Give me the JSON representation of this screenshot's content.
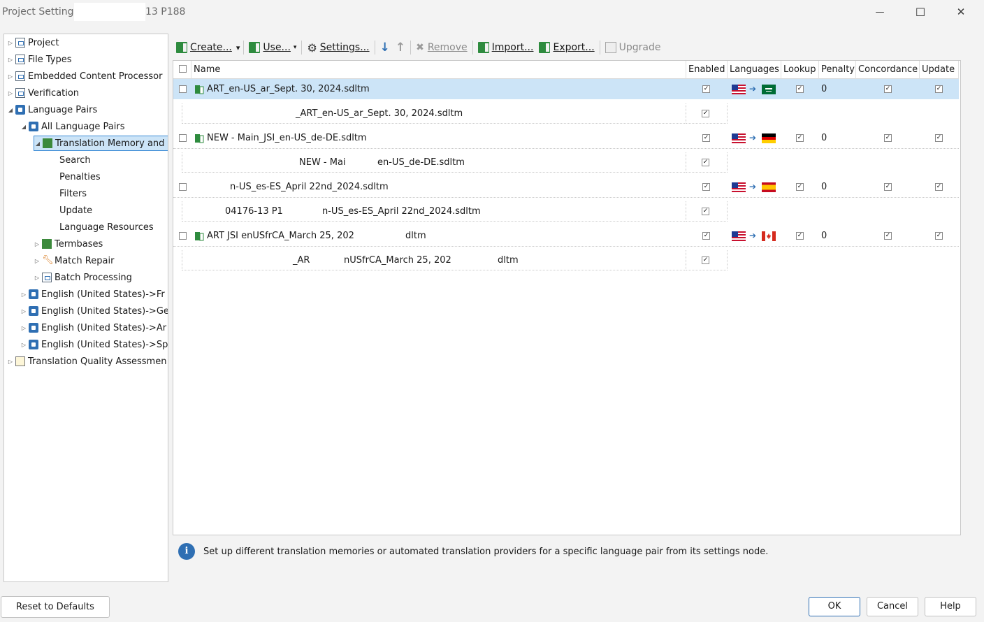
{
  "window": {
    "title_left": "Project Settings",
    "title_right": "13 P188",
    "minimize_glyph": "—",
    "maximize_glyph": "☐",
    "close_glyph": "✕"
  },
  "tree": {
    "items": [
      {
        "label": "Project",
        "icon": "project-icon"
      },
      {
        "label": "File Types",
        "icon": "file-types-icon"
      },
      {
        "label": "Embedded Content Processor",
        "icon": "embedded-content-icon"
      },
      {
        "label": "Verification",
        "icon": "verification-icon"
      },
      {
        "label": "Language Pairs",
        "icon": "language-pairs-icon"
      },
      {
        "label": "All Language Pairs",
        "icon": "language-pairs-icon"
      },
      {
        "label": "Translation Memory and",
        "icon": "translation-memory-icon"
      },
      {
        "label": "Search"
      },
      {
        "label": "Penalties"
      },
      {
        "label": "Filters"
      },
      {
        "label": "Update"
      },
      {
        "label": "Language Resources"
      },
      {
        "label": "Termbases",
        "icon": "termbase-icon"
      },
      {
        "label": "Match Repair",
        "icon": "wrench-icon"
      },
      {
        "label": "Batch Processing",
        "icon": "batch-icon"
      },
      {
        "label": "English (United States)->Fr",
        "icon": "language-pairs-icon"
      },
      {
        "label": "English (United States)->Ge",
        "icon": "language-pairs-icon"
      },
      {
        "label": "English (United States)->Ar",
        "icon": "language-pairs-icon"
      },
      {
        "label": "English (United States)->Sp",
        "icon": "language-pairs-icon"
      },
      {
        "label": "Translation Quality Assessmen",
        "icon": "clipboard-icon"
      }
    ]
  },
  "toolbar": {
    "create": "Create...",
    "use": "Use...",
    "settings": "Settings...",
    "remove": "Remove",
    "import": "Import...",
    "export": "Export...",
    "upgrade": "Upgrade"
  },
  "grid": {
    "columns": [
      "Name",
      "Enabled",
      "Languages",
      "Lookup",
      "Penalty",
      "Concordance",
      "Update"
    ],
    "rows": [
      {
        "name": "ART_en-US_ar_Sept. 30, 2024.sdltm",
        "sub_name": "_ART_en-US_ar_Sept. 30, 2024.sdltm",
        "penalty": "0",
        "target_flag": "saudi-arabia-flag"
      },
      {
        "name": "NEW - Main_JSI_en-US_de-DE.sdltm",
        "sub_name_a": "NEW - Mai",
        "sub_name_b": "en-US_de-DE.sdltm",
        "penalty": "0",
        "target_flag": "germany-flag"
      },
      {
        "name": "n-US_es-ES_April 22nd_2024.sdltm",
        "sub_name_a": "04176-13 P1",
        "sub_name_b": "n-US_es-ES_April 22nd_2024.sdltm",
        "penalty": "0",
        "target_flag": "spain-flag"
      },
      {
        "name_a": "ART JSI enUSfrCA_March 25, 202",
        "name_b": "dltm",
        "sub_name_a": "_AR",
        "sub_name_b": "nUSfrCA_March 25, 202",
        "sub_name_c": "dltm",
        "penalty": "0",
        "target_flag": "canada-flag"
      }
    ]
  },
  "info": {
    "text": "Set up different translation memories or automated translation providers for a specific language pair from its settings node."
  },
  "buttons": {
    "reset": "Reset to Defaults",
    "ok": "OK",
    "cancel": "Cancel",
    "help": "Help"
  },
  "symbols": {
    "check": "✓",
    "arrow": "➔",
    "expanded": "◢",
    "collapsed": "▷",
    "gear": "⚙",
    "caret": "▾",
    "remove_x": "✖",
    "down": "↓",
    "up": "↑",
    "info": "i"
  }
}
